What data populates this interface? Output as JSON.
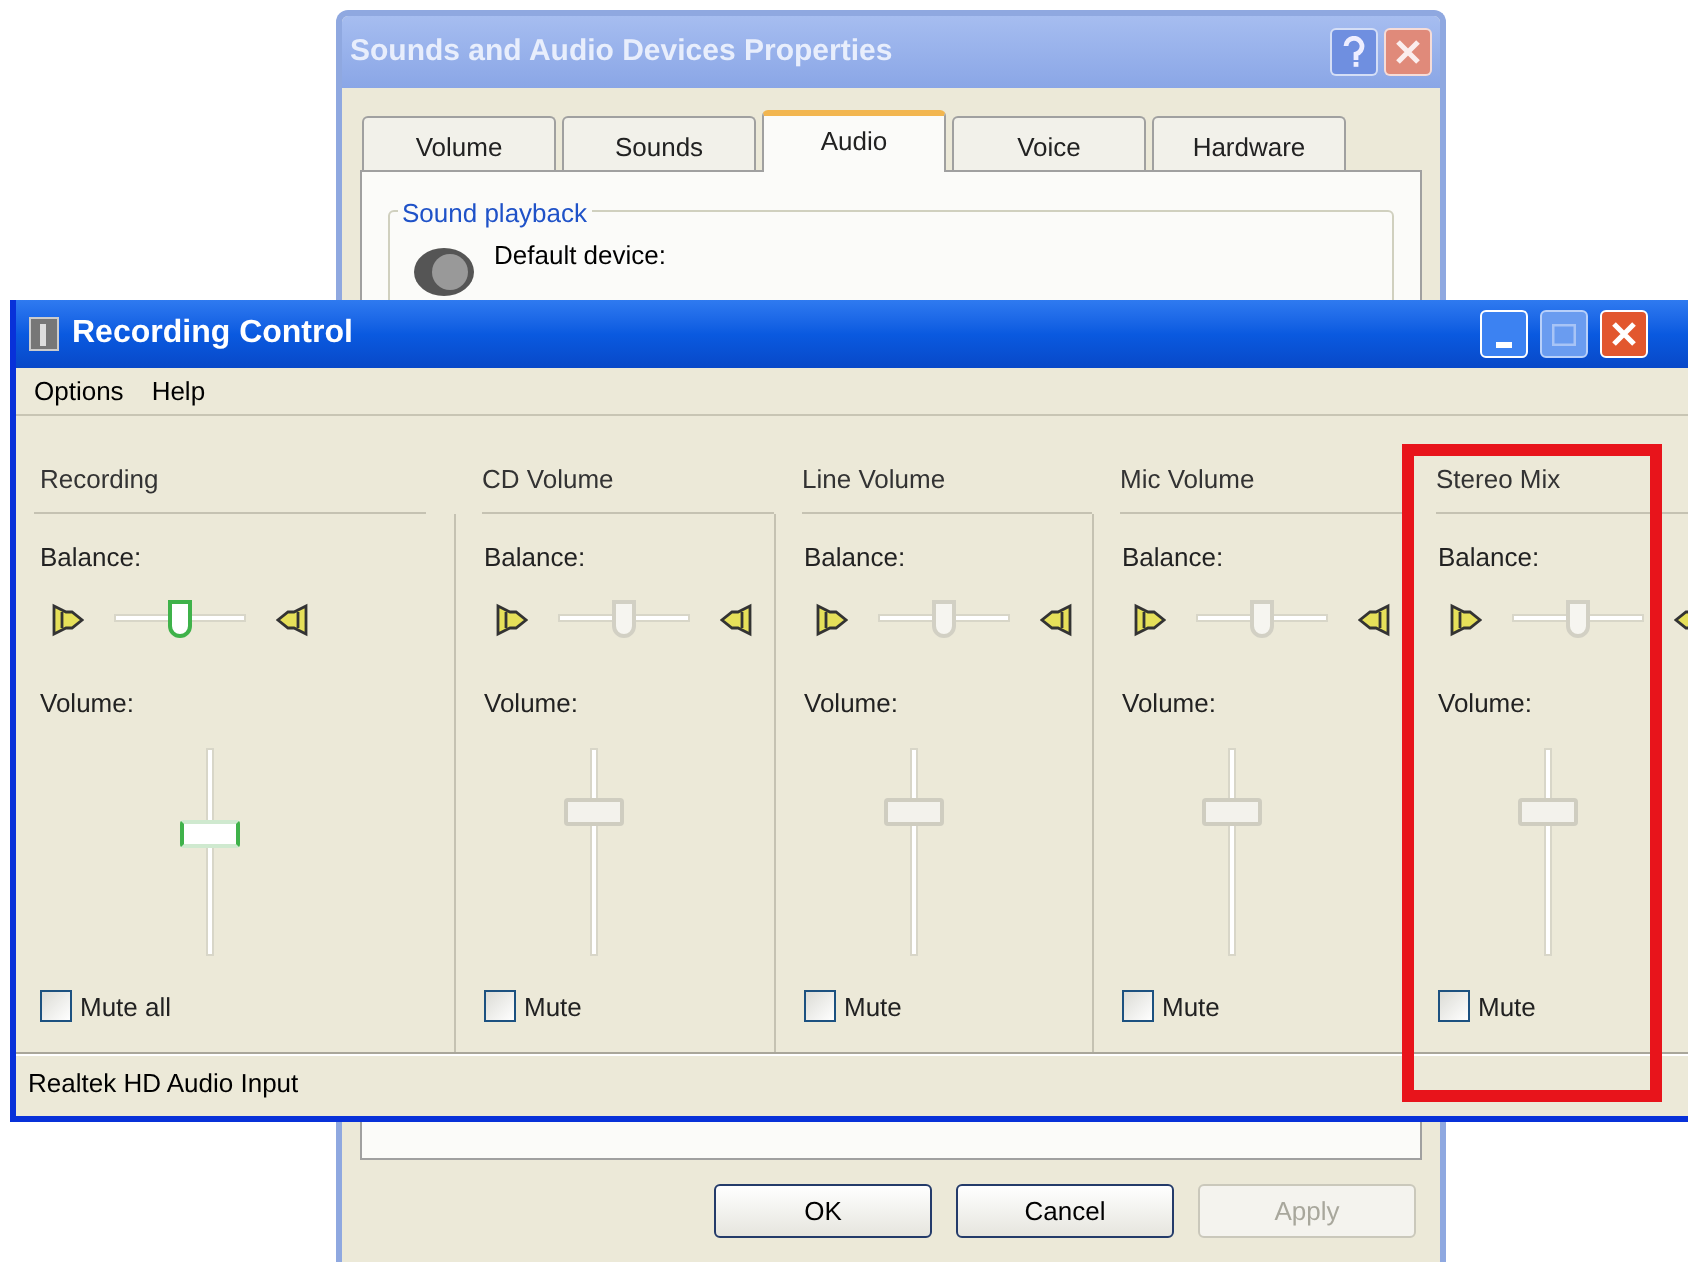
{
  "back_dialog": {
    "title": "Sounds and Audio Devices Properties",
    "tabs": [
      {
        "label": "Volume",
        "selected": false
      },
      {
        "label": "Sounds",
        "selected": false
      },
      {
        "label": "Audio",
        "selected": true
      },
      {
        "label": "Voice",
        "selected": false
      },
      {
        "label": "Hardware",
        "selected": false
      }
    ],
    "group_title": "Sound playback",
    "default_device_label": "Default device:",
    "buttons": [
      {
        "label": "OK",
        "disabled": false
      },
      {
        "label": "Cancel",
        "disabled": false
      },
      {
        "label": "Apply",
        "disabled": true
      }
    ]
  },
  "window": {
    "title": "Recording Control",
    "menu": [
      "Options",
      "Help"
    ],
    "columns": [
      {
        "name": "Recording",
        "balance_label": "Balance:",
        "balance": {
          "level": 0.5
        },
        "volume_label": "Volume:",
        "volume": {
          "level": 0.59
        },
        "mute": {
          "label": "Mute all",
          "checked": false
        },
        "focused": true,
        "highlighted": false
      },
      {
        "name": "CD Volume",
        "balance_label": "Balance:",
        "balance": {
          "level": 0.5
        },
        "volume_label": "Volume:",
        "volume": {
          "level": 0.71
        },
        "mute": {
          "label": "Mute",
          "checked": false
        },
        "focused": false,
        "highlighted": false
      },
      {
        "name": "Line Volume",
        "balance_label": "Balance:",
        "balance": {
          "level": 0.5
        },
        "volume_label": "Volume:",
        "volume": {
          "level": 0.71
        },
        "mute": {
          "label": "Mute",
          "checked": false
        },
        "focused": false,
        "highlighted": false
      },
      {
        "name": "Mic Volume",
        "balance_label": "Balance:",
        "balance": {
          "level": 0.5
        },
        "volume_label": "Volume:",
        "volume": {
          "level": 0.71
        },
        "mute": {
          "label": "Mute",
          "checked": false
        },
        "focused": false,
        "highlighted": false
      },
      {
        "name": "Stereo Mix",
        "balance_label": "Balance:",
        "balance": {
          "level": 0.5
        },
        "volume_label": "Volume:",
        "volume": {
          "level": 0.71
        },
        "mute": {
          "label": "Mute",
          "checked": false
        },
        "focused": false,
        "highlighted": true
      }
    ],
    "status_bar": "Realtek HD Audio Input"
  }
}
